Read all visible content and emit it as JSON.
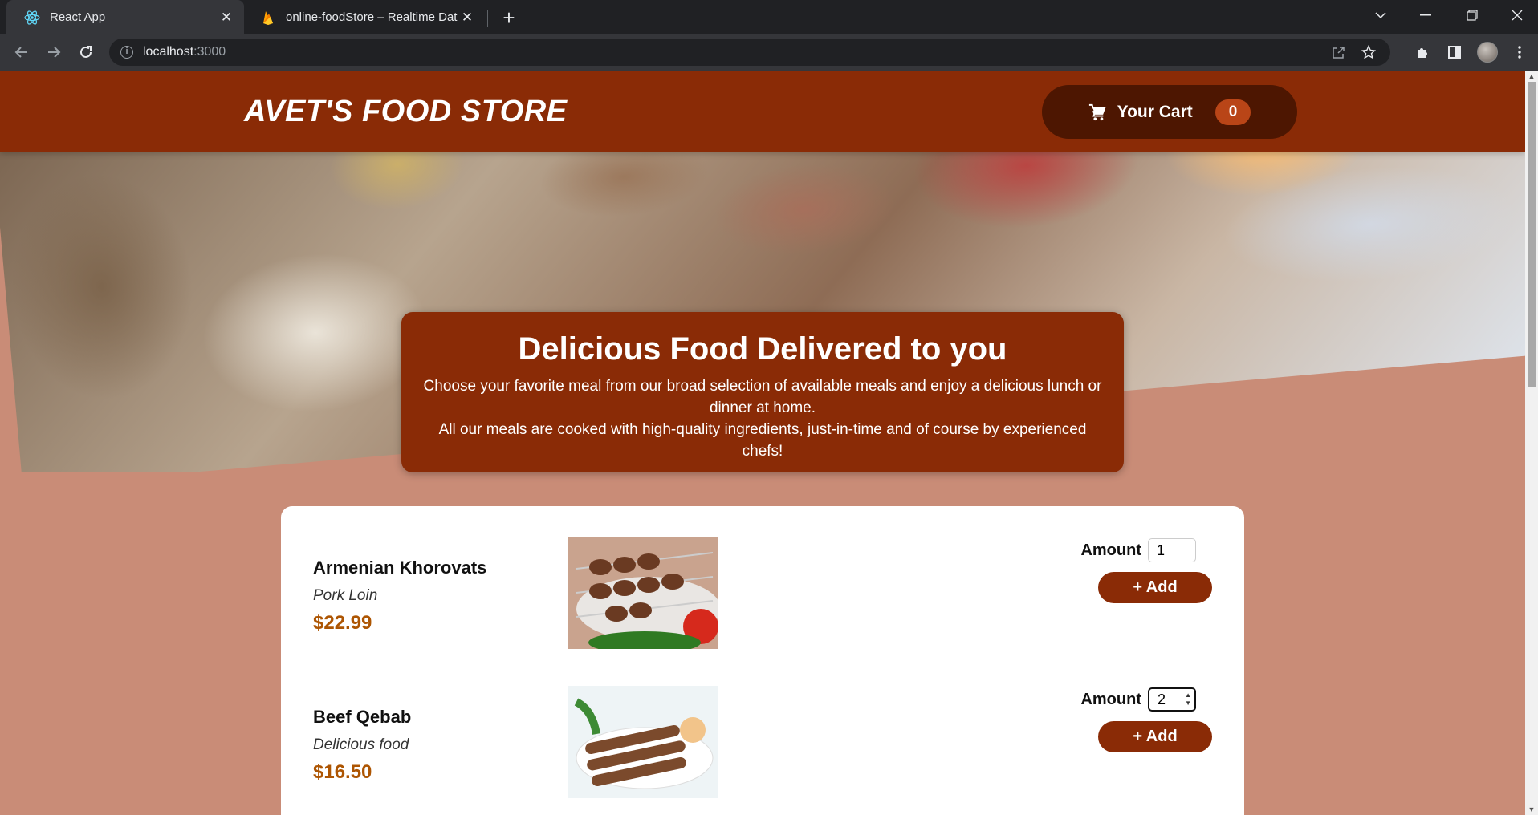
{
  "browser": {
    "tabs": [
      {
        "title": "React App",
        "icon": "react-icon"
      },
      {
        "title": "online-foodStore – Realtime Data",
        "icon": "firebase-icon"
      }
    ],
    "url_host": "localhost",
    "url_port": ":3000"
  },
  "header": {
    "logo": "AVET'S FOOD STORE",
    "cart_label": "Your Cart",
    "cart_count": "0"
  },
  "hero": {
    "title": "Delicious Food Delivered to you",
    "line1": "Choose your favorite meal from our broad selection of available meals and enjoy a delicious lunch or dinner at home.",
    "line2": "All our meals are cooked with high-quality ingredients, just-in-time and of course by experienced chefs!"
  },
  "meals": [
    {
      "name": "Armenian Khorovats",
      "description": "Pork Loin",
      "price": "$22.99",
      "amount_label": "Amount",
      "amount": "1",
      "add_label": "+ Add"
    },
    {
      "name": "Beef Qebab",
      "description": "Delicious food",
      "price": "$16.50",
      "amount_label": "Amount",
      "amount": "2",
      "add_label": "+ Add"
    }
  ],
  "colors": {
    "brand": "#8a2b06",
    "cart_dark": "#4d1601",
    "badge": "#b94517",
    "price": "#ad5502",
    "page_bg": "#c98c77"
  }
}
